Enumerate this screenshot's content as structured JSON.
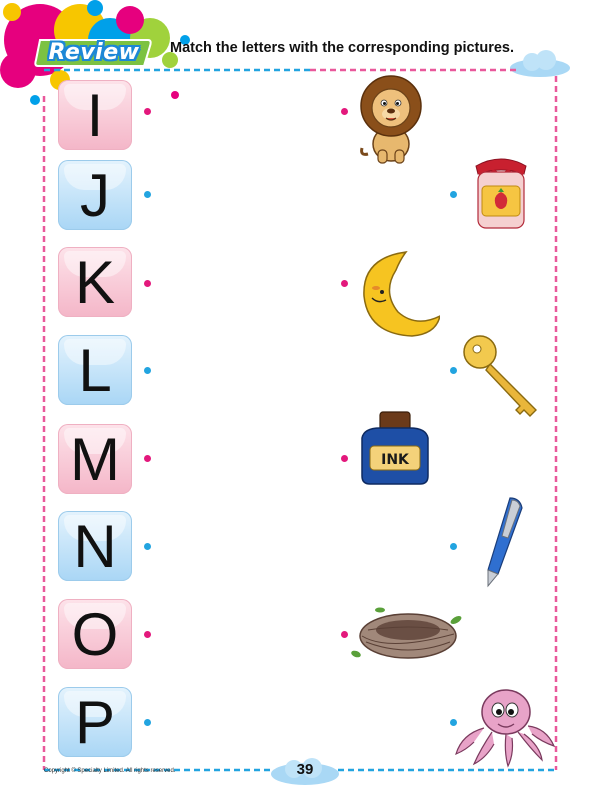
{
  "header": {
    "badge_label": "Review",
    "instruction": "Match the letters with the corresponding pictures."
  },
  "letters": [
    {
      "letter": "I",
      "color": "pink"
    },
    {
      "letter": "J",
      "color": "blue"
    },
    {
      "letter": "K",
      "color": "pink"
    },
    {
      "letter": "L",
      "color": "blue"
    },
    {
      "letter": "M",
      "color": "pink"
    },
    {
      "letter": "N",
      "color": "blue"
    },
    {
      "letter": "O",
      "color": "pink"
    },
    {
      "letter": "P",
      "color": "blue"
    }
  ],
  "pictures": [
    {
      "icon": "lion-icon",
      "dot_color": "pink"
    },
    {
      "icon": "jam-jar-icon",
      "dot_color": "blue"
    },
    {
      "icon": "moon-icon",
      "dot_color": "pink"
    },
    {
      "icon": "key-icon",
      "dot_color": "blue"
    },
    {
      "icon": "ink-bottle-icon",
      "dot_color": "pink",
      "label": "INK"
    },
    {
      "icon": "pen-icon",
      "dot_color": "blue"
    },
    {
      "icon": "nest-icon",
      "dot_color": "pink"
    },
    {
      "icon": "octopus-icon",
      "dot_color": "blue"
    }
  ],
  "colors": {
    "pink": "#e3187c",
    "blue": "#22a4e0",
    "badge_green": "#7cc242",
    "badge_outline": "#1d87d6"
  },
  "footer": {
    "page_number": "39",
    "copyright": "Copyright © Specialty Limited. All rights reserved."
  }
}
